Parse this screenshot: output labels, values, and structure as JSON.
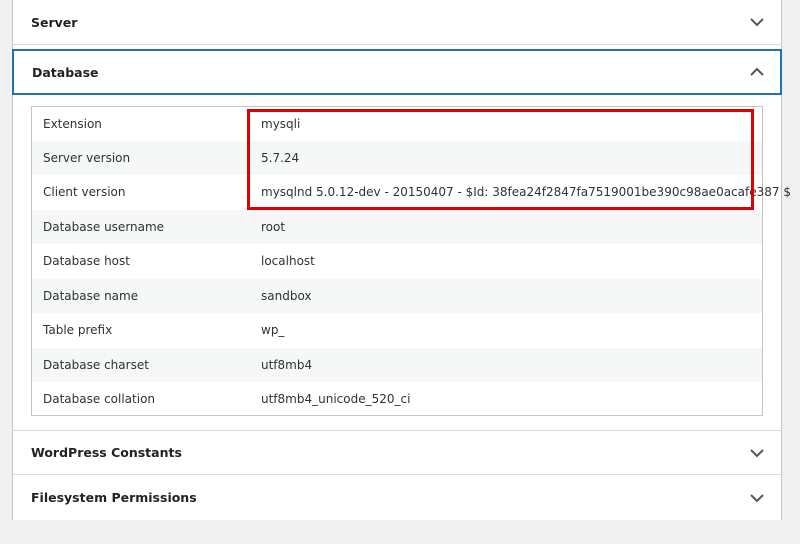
{
  "sections": {
    "server": {
      "title": "Server",
      "icon": "chevron-down-icon"
    },
    "database": {
      "title": "Database",
      "icon": "chevron-up-icon"
    },
    "constants": {
      "title": "WordPress Constants",
      "icon": "chevron-down-icon"
    },
    "filesystem": {
      "title": "Filesystem Permissions",
      "icon": "chevron-down-icon"
    }
  },
  "database_rows": [
    {
      "label": "Extension",
      "value": "mysqli"
    },
    {
      "label": "Server version",
      "value": "5.7.24"
    },
    {
      "label": "Client version",
      "value": "mysqlnd 5.0.12-dev - 20150407 - $Id: 38fea24f2847fa7519001be390c98ae0acafe387 $"
    },
    {
      "label": "Database username",
      "value": "root"
    },
    {
      "label": "Database host",
      "value": "localhost"
    },
    {
      "label": "Database name",
      "value": "sandbox"
    },
    {
      "label": "Table prefix",
      "value": "wp_"
    },
    {
      "label": "Database charset",
      "value": "utf8mb4"
    },
    {
      "label": "Database collation",
      "value": "utf8mb4_unicode_520_ci"
    }
  ],
  "colors": {
    "accent": "#2271b1",
    "highlight": "#e00000",
    "row_alt": "#f6f7f7",
    "background": "#f0f0f1"
  }
}
